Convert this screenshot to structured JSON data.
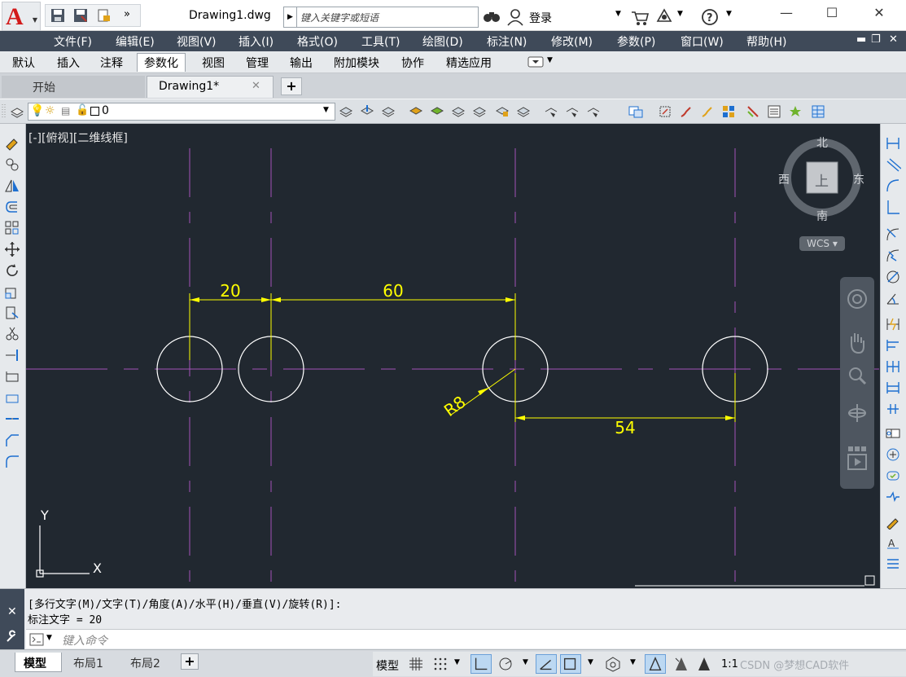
{
  "titlebar": {
    "doc_title": "Drawing1.dwg",
    "search_placeholder": "键入关键字或短语",
    "login_label": "登录",
    "app_letter": "A"
  },
  "menu": [
    "文件(F)",
    "编辑(E)",
    "视图(V)",
    "插入(I)",
    "格式(O)",
    "工具(T)",
    "绘图(D)",
    "标注(N)",
    "修改(M)",
    "参数(P)",
    "窗口(W)",
    "帮助(H)"
  ],
  "ribbon_tabs": [
    "默认",
    "插入",
    "注释",
    "参数化",
    "视图",
    "管理",
    "输出",
    "附加模块",
    "协作",
    "精选应用"
  ],
  "ribbon_active": "参数化",
  "file_tabs": {
    "start": "开始",
    "doc": "Drawing1*"
  },
  "layer": {
    "name": "0"
  },
  "viewport": {
    "label": "[-][俯视][二维线框]"
  },
  "viewcube": {
    "north": "北",
    "south": "南",
    "east": "东",
    "west": "西",
    "top": "上",
    "wcs": "WCS"
  },
  "drawing": {
    "dim_1": "20",
    "dim_2": "60",
    "dim_3": "54",
    "radius": "R8",
    "ucs_x": "X",
    "ucs_y": "Y"
  },
  "command": {
    "line1": "[多行文字(M)/文字(T)/角度(A)/水平(H)/垂直(V)/旋转(R)]:",
    "line2": "标注文字 = 20",
    "placeholder": "键入命令"
  },
  "layout_tabs": [
    "模型",
    "布局1",
    "布局2"
  ],
  "status": {
    "model_label": "模型",
    "scale": "1:1",
    "watermark": "CSDN @梦想CAD软件"
  }
}
